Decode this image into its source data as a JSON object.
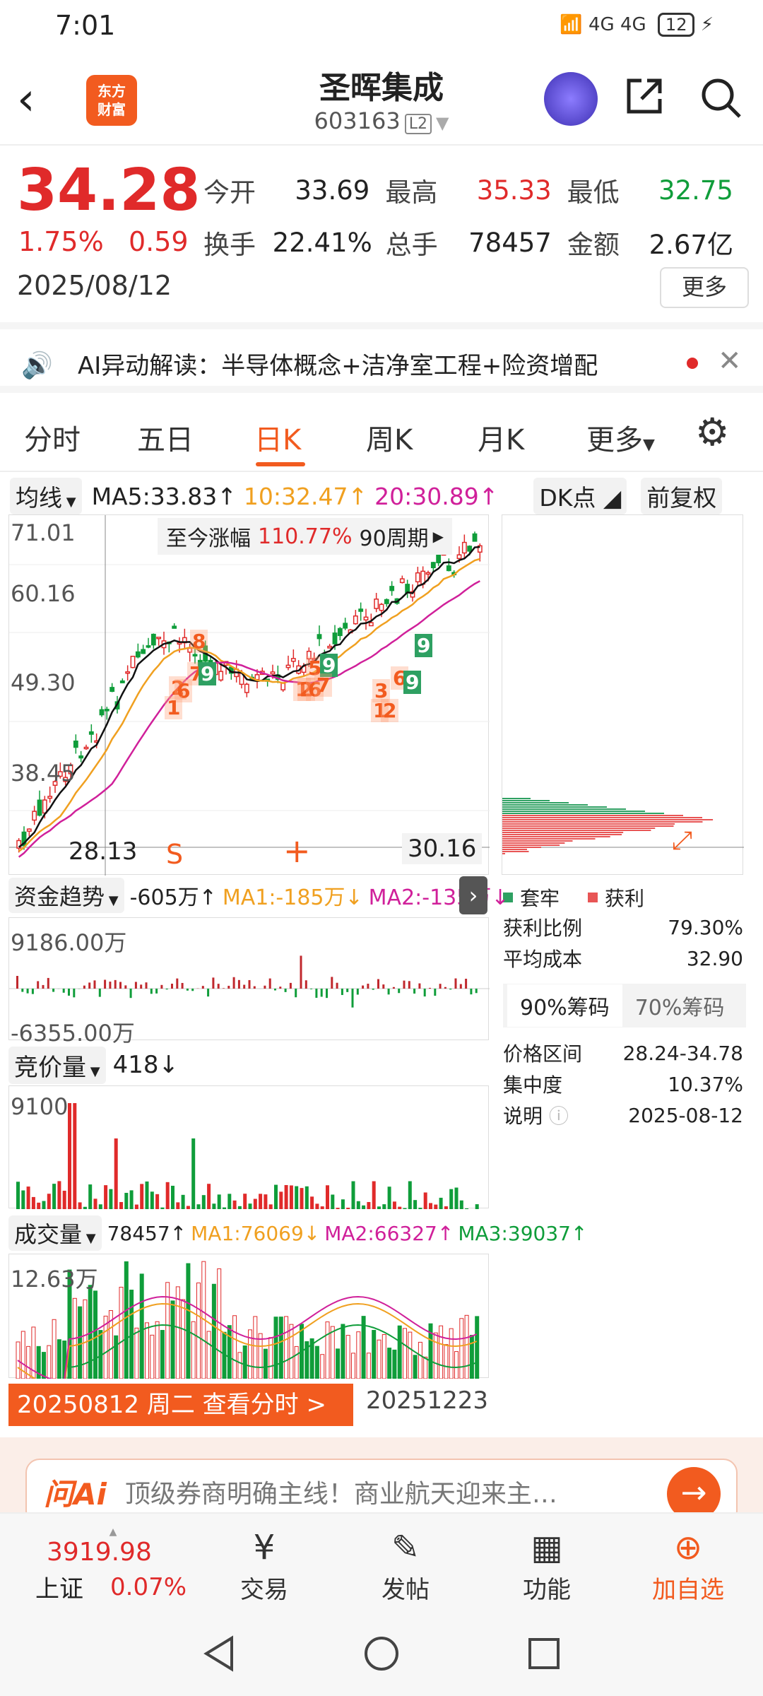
{
  "status": {
    "time": "7:01",
    "signal": "4G 4G",
    "battery": "12"
  },
  "header": {
    "title": "圣晖集成",
    "code": "603163",
    "level": "L2",
    "logo": "东方\n财富"
  },
  "quote": {
    "price": "34.28",
    "change_pct": "1.75%",
    "change": "0.59",
    "date": "2025/08/12",
    "rows": [
      [
        {
          "k": "今开",
          "v": "33.69",
          "c": ""
        },
        {
          "k": "最高",
          "v": "35.33",
          "c": "up"
        },
        {
          "k": "最低",
          "v": "32.75",
          "c": "down"
        }
      ],
      [
        {
          "k": "换手",
          "v": "22.41%",
          "c": ""
        },
        {
          "k": "总手",
          "v": "78457",
          "c": ""
        },
        {
          "k": "金额",
          "v": "2.67亿",
          "c": ""
        }
      ]
    ],
    "more_label": "更多"
  },
  "ai_bar": {
    "text": "AI异动解读：半导体概念+洁净室工程+险资增配"
  },
  "tabs": [
    "分时",
    "五日",
    "日K",
    "周K",
    "月K",
    "更多"
  ],
  "toolbar": {
    "ma_label": "均线",
    "ma5": "MA5:33.83↑",
    "ma10": "10:32.47↑",
    "ma20": "20:30.89↑",
    "dk": "DK点",
    "fq": "前复权"
  },
  "kchart": {
    "y_ticks": [
      "71.01",
      "60.16",
      "49.30",
      "38.45"
    ],
    "range_label": "至今涨幅",
    "range_value": "110.77%",
    "period": "90周期",
    "cursor_price": "28.13",
    "cursor_right": "30.16",
    "badges": [
      "8",
      "7",
      "9",
      "2",
      "6",
      "1",
      "5",
      "9",
      "1",
      "2",
      "6",
      "7",
      "3",
      "1",
      "2",
      "6",
      "9",
      "9"
    ]
  },
  "fund": {
    "label": "资金趋势",
    "value": "-605万↑",
    "ma1": "MA1:-185万↓",
    "ma2": "MA2:-135万↓",
    "top": "9186.00万",
    "bottom": "-6355.00万"
  },
  "auction": {
    "label": "竞价量",
    "value": "418↓",
    "top": "9100"
  },
  "volume": {
    "label": "成交量",
    "value": "78457↑",
    "ma1": "MA1:76069↓",
    "ma2": "MA2:66327↑",
    "ma3": "MA3:39037↑",
    "top": "12.63万"
  },
  "date_bar": {
    "left": "20250812 周二 查看分时 >",
    "right": "20251223"
  },
  "chips": {
    "legend_trap": "套牢",
    "legend_profit": "获利",
    "rows1": [
      {
        "k": "获利比例",
        "v": "79.30%"
      },
      {
        "k": "平均成本",
        "v": "32.90"
      }
    ],
    "tab_active": "90%筹码",
    "tab_other": "70%筹码",
    "rows2": [
      {
        "k": "价格区间",
        "v": "28.24-34.78"
      },
      {
        "k": "集中度",
        "v": "10.37%"
      },
      {
        "k": "说明",
        "v": "2025-08-12"
      }
    ]
  },
  "ad": {
    "brand": "问Ai",
    "text": "顶级券商明确主线！商业航天迎来主…"
  },
  "bottom_nav": {
    "index_price": "3919.98",
    "index_name": "上证",
    "index_pct": "0.07%",
    "items": [
      {
        "label": "交易",
        "icon": "¥"
      },
      {
        "label": "发帖",
        "icon": "✎"
      },
      {
        "label": "功能",
        "icon": "▦"
      },
      {
        "label": "加自选",
        "icon": "⊕"
      }
    ]
  },
  "colors": {
    "up": "#e02a2a",
    "down": "#0f9d3a",
    "accent": "#f25b1f"
  }
}
